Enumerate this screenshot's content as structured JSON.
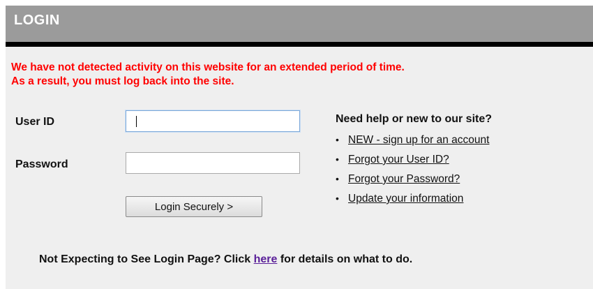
{
  "header": {
    "title": "LOGIN"
  },
  "warning": {
    "line1": "We have not detected activity on this website for an extended period of time.",
    "line2": "As a result, you must log back into the site."
  },
  "form": {
    "userid_label": "User ID",
    "userid_value": "",
    "password_label": "Password",
    "password_value": "",
    "login_button": "Login Securely >"
  },
  "help": {
    "title": "Need help or new to our site?",
    "bullet": "•",
    "links": [
      "NEW - sign up for an account",
      "Forgot your User ID?",
      "Forgot your Password?",
      "Update your information"
    ]
  },
  "footer": {
    "prefix": "Not Expecting to See Login Page? Click ",
    "link": "here",
    "suffix": " for details on what to do."
  },
  "colors": {
    "header_bg": "#9b9b9b",
    "panel_bg": "#efefef",
    "warning_text": "#ff0000",
    "visited_link": "#5a1f99"
  }
}
